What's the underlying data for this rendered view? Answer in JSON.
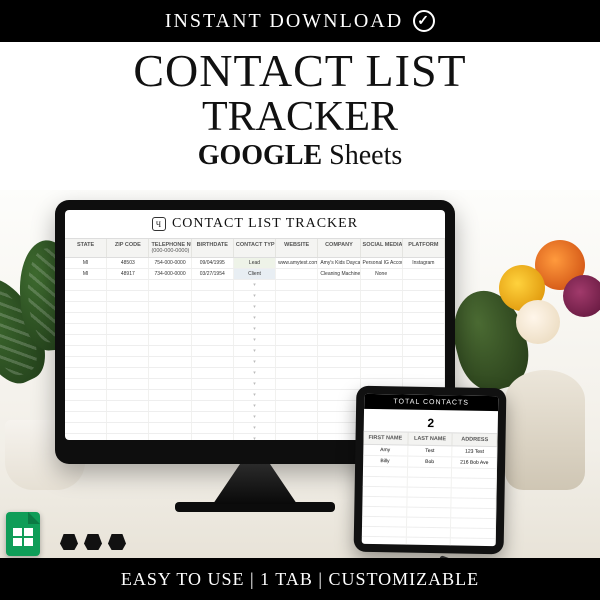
{
  "banner_top": "INSTANT DOWNLOAD",
  "title_line1": "CONTACT LIST",
  "title_line2": "TRACKER",
  "title_platform_bold": "GOOGLE",
  "title_platform_thin": "Sheets",
  "banner_bottom": "EASY TO USE | 1 TAB | CUSTOMIZABLE",
  "monitor": {
    "sheet_title": "CONTACT LIST TRACKER",
    "headers": [
      "STATE",
      "ZIP CODE",
      "TELEPHONE NUMBER",
      "BIRTHDATE",
      "CONTACT TYPE",
      "WEBSITE",
      "COMPANY",
      "SOCIAL MEDIA",
      "PLATFORM"
    ],
    "phone_placeholder": "(000-000-0000)",
    "rows": [
      {
        "state": "MI",
        "zip": "48503",
        "phone": "754-000-0000",
        "birth": "09/04/1995",
        "type": "Lead",
        "type_class": "tag-lead",
        "site": "www.amytest.com",
        "company": "Amy's Kids Daycare",
        "social": "Personal IG Account",
        "platform": "Instagram"
      },
      {
        "state": "MI",
        "zip": "48917",
        "phone": "734-000-0000",
        "birth": "03/27/1954",
        "type": "Client",
        "type_class": "tag-client",
        "site": "",
        "company": "Cleaning Machine Service",
        "social": "None",
        "platform": ""
      }
    ]
  },
  "tablet": {
    "top_label": "TOTAL CONTACTS",
    "total": "2",
    "headers": [
      "FIRST NAME",
      "LAST NAME",
      "ADDRESS"
    ],
    "rows": [
      {
        "first": "Amy",
        "last": "Test",
        "addr": "123 Test"
      },
      {
        "first": "Billy",
        "last": "Bob",
        "addr": "216 Bob Ave"
      }
    ]
  }
}
